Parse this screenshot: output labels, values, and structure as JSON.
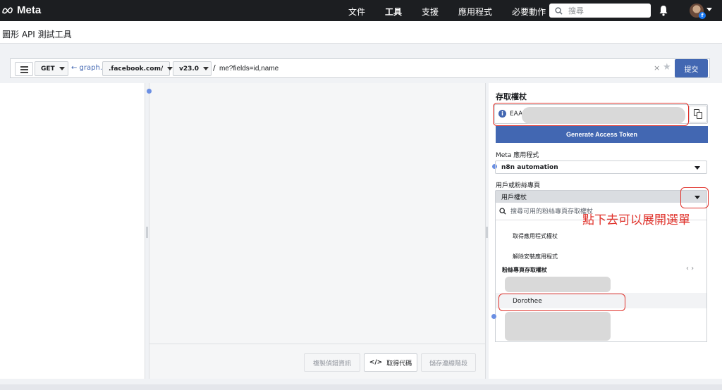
{
  "brand": {
    "name": "Meta",
    "color": "#1c1e21",
    "accent": "#4267b2",
    "annotation_color": "#e0312a"
  },
  "topnav": {
    "items": [
      {
        "label": "文件",
        "active": false
      },
      {
        "label": "工具",
        "active": true
      },
      {
        "label": "支援",
        "active": false
      },
      {
        "label": "應用程式",
        "active": false
      },
      {
        "label": "必要動作",
        "active": false
      }
    ],
    "search_placeholder": "搜尋"
  },
  "page_title": "圖形 API 測試工具",
  "query": {
    "method": "GET",
    "graph_link": "← graph.",
    "domain": ".facebook.com/",
    "version": "v23.0",
    "slash": "/",
    "path": "me?fields=id,name",
    "clear": "×",
    "star": "★",
    "submit": "提交"
  },
  "bottom_actions": {
    "copy_debug": "複製偵錯資訊",
    "get_code": "取得代碼",
    "save_session": "儲存連線階段"
  },
  "access": {
    "title": "存取權杖",
    "token_prefix": "EAA",
    "generate": "Generate Access Token",
    "app_label": "Meta 應用程式",
    "app_value": "n8n automation",
    "user_page_label": "用戶或粉絲專頁",
    "user_page_value": "用戶權杖"
  },
  "dropdown": {
    "search_placeholder": "搜尋可用的粉絲專頁存取權杖",
    "items": [
      "取得應用程式權杖",
      "解除安裝應用程式"
    ],
    "group_label": "粉絲專頁存取權杖",
    "pager": "‹ ›",
    "person": "Dorothee"
  },
  "annotation": "點下去可以展開選單"
}
